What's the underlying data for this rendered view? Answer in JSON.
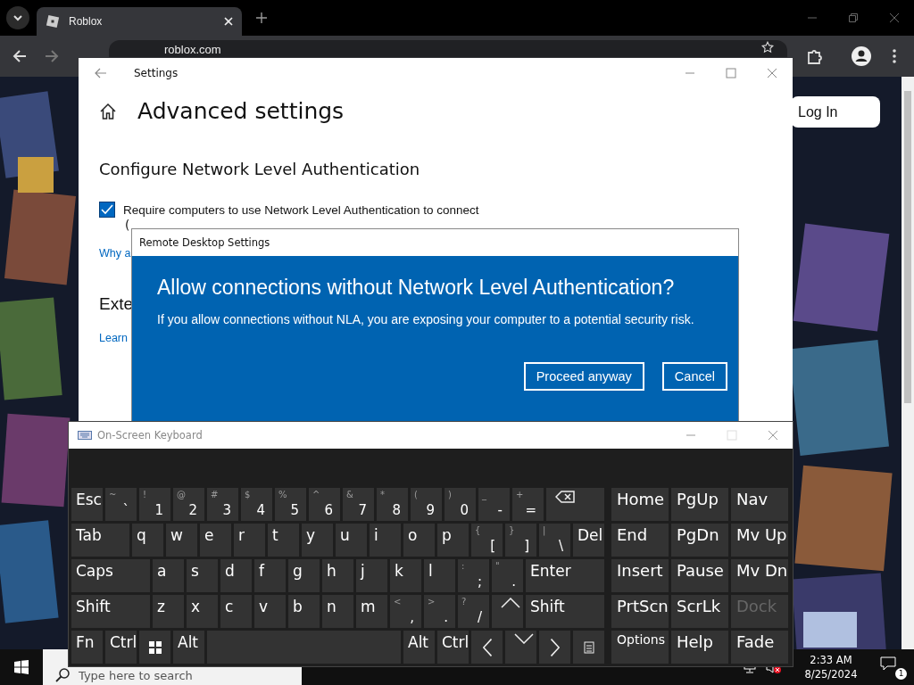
{
  "browser": {
    "tab_title": "Roblox",
    "url": "roblox.com",
    "login_button": "Log In"
  },
  "settings_window": {
    "title": "Settings",
    "heading": "Advanced settings",
    "section_title": "Configure Network Level Authentication",
    "nla_checkbox": {
      "label": "Require computers to use Network Level Authentication to connect",
      "checked": true
    },
    "checkbox_note": "(",
    "help_link": "Why a",
    "section_title_2": "Exte",
    "learn_link": "Learn"
  },
  "dialog": {
    "title": "Remote Desktop Settings",
    "heading": "Allow connections without Network Level Authentication?",
    "message": "If you allow connections without NLA, you are exposing your computer to a potential security risk.",
    "buttons": [
      "Proceed anyway",
      "Cancel"
    ]
  },
  "keyboard": {
    "title": "On-Screen Keyboard",
    "rows": [
      {
        "keys": [
          {
            "kind": "key",
            "label": "Esc"
          },
          {
            "kind": "key",
            "label": "`",
            "shift": "~"
          },
          {
            "kind": "key",
            "label": "1",
            "shift": "!"
          },
          {
            "kind": "key",
            "label": "2",
            "shift": "@"
          },
          {
            "kind": "key",
            "label": "3",
            "shift": "#"
          },
          {
            "kind": "key",
            "label": "4",
            "shift": "$"
          },
          {
            "kind": "key",
            "label": "5",
            "shift": "%"
          },
          {
            "kind": "key",
            "label": "6",
            "shift": "^"
          },
          {
            "kind": "key",
            "label": "7",
            "shift": "&"
          },
          {
            "kind": "key",
            "label": "8",
            "shift": "*"
          },
          {
            "kind": "key",
            "label": "9",
            "shift": "("
          },
          {
            "kind": "key",
            "label": "0",
            "shift": ")"
          },
          {
            "kind": "key",
            "label": "-",
            "shift": "_"
          },
          {
            "kind": "key",
            "label": "=",
            "shift": "+"
          },
          {
            "kind": "backspace"
          }
        ]
      },
      {
        "keys": [
          {
            "kind": "wide",
            "label": "Tab"
          },
          {
            "kind": "key",
            "label": "q"
          },
          {
            "kind": "key",
            "label": "w"
          },
          {
            "kind": "key",
            "label": "e"
          },
          {
            "kind": "key",
            "label": "r"
          },
          {
            "kind": "key",
            "label": "t"
          },
          {
            "kind": "key",
            "label": "y"
          },
          {
            "kind": "key",
            "label": "u"
          },
          {
            "kind": "key",
            "label": "i"
          },
          {
            "kind": "key",
            "label": "o"
          },
          {
            "kind": "key",
            "label": "p"
          },
          {
            "kind": "key",
            "label": "[",
            "shift": "{"
          },
          {
            "kind": "key",
            "label": "]",
            "shift": "}"
          },
          {
            "kind": "key",
            "label": "\\",
            "shift": "|"
          },
          {
            "kind": "key",
            "label": "Del"
          }
        ]
      },
      {
        "keys": [
          {
            "kind": "wide",
            "label": "Caps"
          },
          {
            "kind": "key",
            "label": "a"
          },
          {
            "kind": "key",
            "label": "s"
          },
          {
            "kind": "key",
            "label": "d"
          },
          {
            "kind": "key",
            "label": "f"
          },
          {
            "kind": "key",
            "label": "g"
          },
          {
            "kind": "key",
            "label": "h"
          },
          {
            "kind": "key",
            "label": "j"
          },
          {
            "kind": "key",
            "label": "k"
          },
          {
            "kind": "key",
            "label": "l"
          },
          {
            "kind": "key",
            "label": ";",
            "shift": ":"
          },
          {
            "kind": "key",
            "label": ".",
            "shift": "\""
          },
          {
            "kind": "wide",
            "label": "Enter"
          }
        ]
      },
      {
        "keys": [
          {
            "kind": "wide",
            "label": "Shift"
          },
          {
            "kind": "key",
            "label": "z"
          },
          {
            "kind": "key",
            "label": "x"
          },
          {
            "kind": "key",
            "label": "c"
          },
          {
            "kind": "key",
            "label": "v"
          },
          {
            "kind": "key",
            "label": "b"
          },
          {
            "kind": "key",
            "label": "n"
          },
          {
            "kind": "key",
            "label": "m"
          },
          {
            "kind": "key",
            "label": ",",
            "shift": "<"
          },
          {
            "kind": "key",
            "label": ".",
            "shift": ">"
          },
          {
            "kind": "key",
            "label": "/",
            "shift": "?"
          },
          {
            "kind": "up"
          },
          {
            "kind": "wide",
            "label": "Shift"
          }
        ]
      },
      {
        "keys": [
          {
            "kind": "key",
            "label": "Fn"
          },
          {
            "kind": "key",
            "label": "Ctrl"
          },
          {
            "kind": "windows"
          },
          {
            "kind": "key",
            "label": "Alt"
          },
          {
            "kind": "space"
          },
          {
            "kind": "key",
            "label": "Alt"
          },
          {
            "kind": "key",
            "label": "Ctrl"
          },
          {
            "kind": "left"
          },
          {
            "kind": "down"
          },
          {
            "kind": "right"
          },
          {
            "kind": "menu"
          }
        ]
      }
    ],
    "side_keys": [
      {
        "label": "Home",
        "disabled": false
      },
      {
        "label": "PgUp",
        "disabled": false
      },
      {
        "label": "Nav",
        "disabled": false
      },
      {
        "label": "End",
        "disabled": false
      },
      {
        "label": "PgDn",
        "disabled": false
      },
      {
        "label": "Mv Up",
        "disabled": false
      },
      {
        "label": "Insert",
        "disabled": false
      },
      {
        "label": "Pause",
        "disabled": false
      },
      {
        "label": "Mv Dn",
        "disabled": false
      },
      {
        "label": "PrtScn",
        "disabled": false
      },
      {
        "label": "ScrLk",
        "disabled": false
      },
      {
        "label": "Dock",
        "disabled": true
      },
      {
        "label": "Options",
        "disabled": false
      },
      {
        "label": "Help",
        "disabled": false
      },
      {
        "label": "Fade",
        "disabled": false
      }
    ]
  },
  "taskbar": {
    "search_placeholder": "Type here to search",
    "time": "2:33 AM",
    "date": "8/25/2024",
    "notification_count": "1"
  }
}
